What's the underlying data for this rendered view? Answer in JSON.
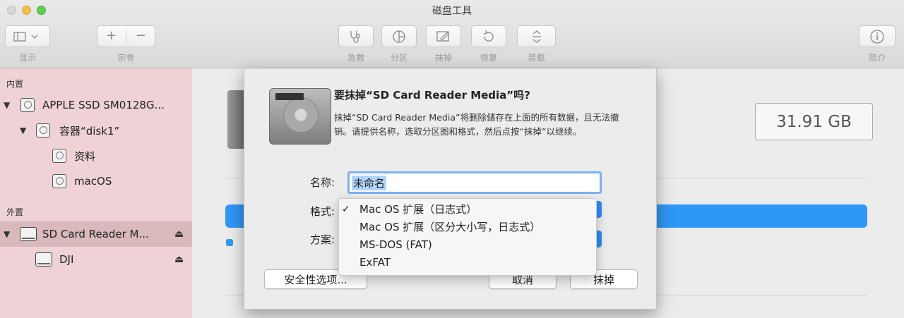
{
  "window": {
    "title": "磁盘工具"
  },
  "toolbar": {
    "view_label": "显示",
    "volume_label": "宗卷",
    "volume_add": "+",
    "volume_remove": "−",
    "first_aid_label": "急救",
    "partition_label": "分区",
    "erase_label": "抹掉",
    "restore_label": "恢复",
    "mount_label": "装载",
    "info_label": "简介"
  },
  "sidebar": {
    "internal_header": "内置",
    "external_header": "外置",
    "items": [
      {
        "label": "APPLE SSD SM0128G..."
      },
      {
        "label": "容器“disk1”"
      },
      {
        "label": "资料"
      },
      {
        "label": "macOS"
      },
      {
        "label": "SD Card Reader M..."
      },
      {
        "label": "DJI"
      }
    ],
    "eject_glyph": "⏏"
  },
  "main": {
    "capacity": "31.91 GB",
    "usage_fraction": 1.0,
    "accent": "#2f97f6"
  },
  "sheet": {
    "title": "要抹掉“SD Card Reader Media”吗?",
    "message": "抹掉“SD Card Reader Media”将删除储存在上面的所有数据，且无法撤销。请提供名称，选取分区图和格式，然后点按“抹掉”以继续。",
    "name_label": "名称:",
    "name_value": "未命名",
    "format_label": "格式:",
    "scheme_label": "方案:",
    "format_options": [
      {
        "label": "Mac OS 扩展（日志式）",
        "checked": true
      },
      {
        "label": "Mac OS 扩展（区分大小写，日志式）",
        "checked": false
      },
      {
        "label": "MS-DOS (FAT)",
        "checked": false
      },
      {
        "label": "ExFAT",
        "checked": false
      }
    ],
    "check_glyph": "✓",
    "security_button": "安全性选项...",
    "cancel_button": "取消",
    "erase_button": "抹掉"
  }
}
